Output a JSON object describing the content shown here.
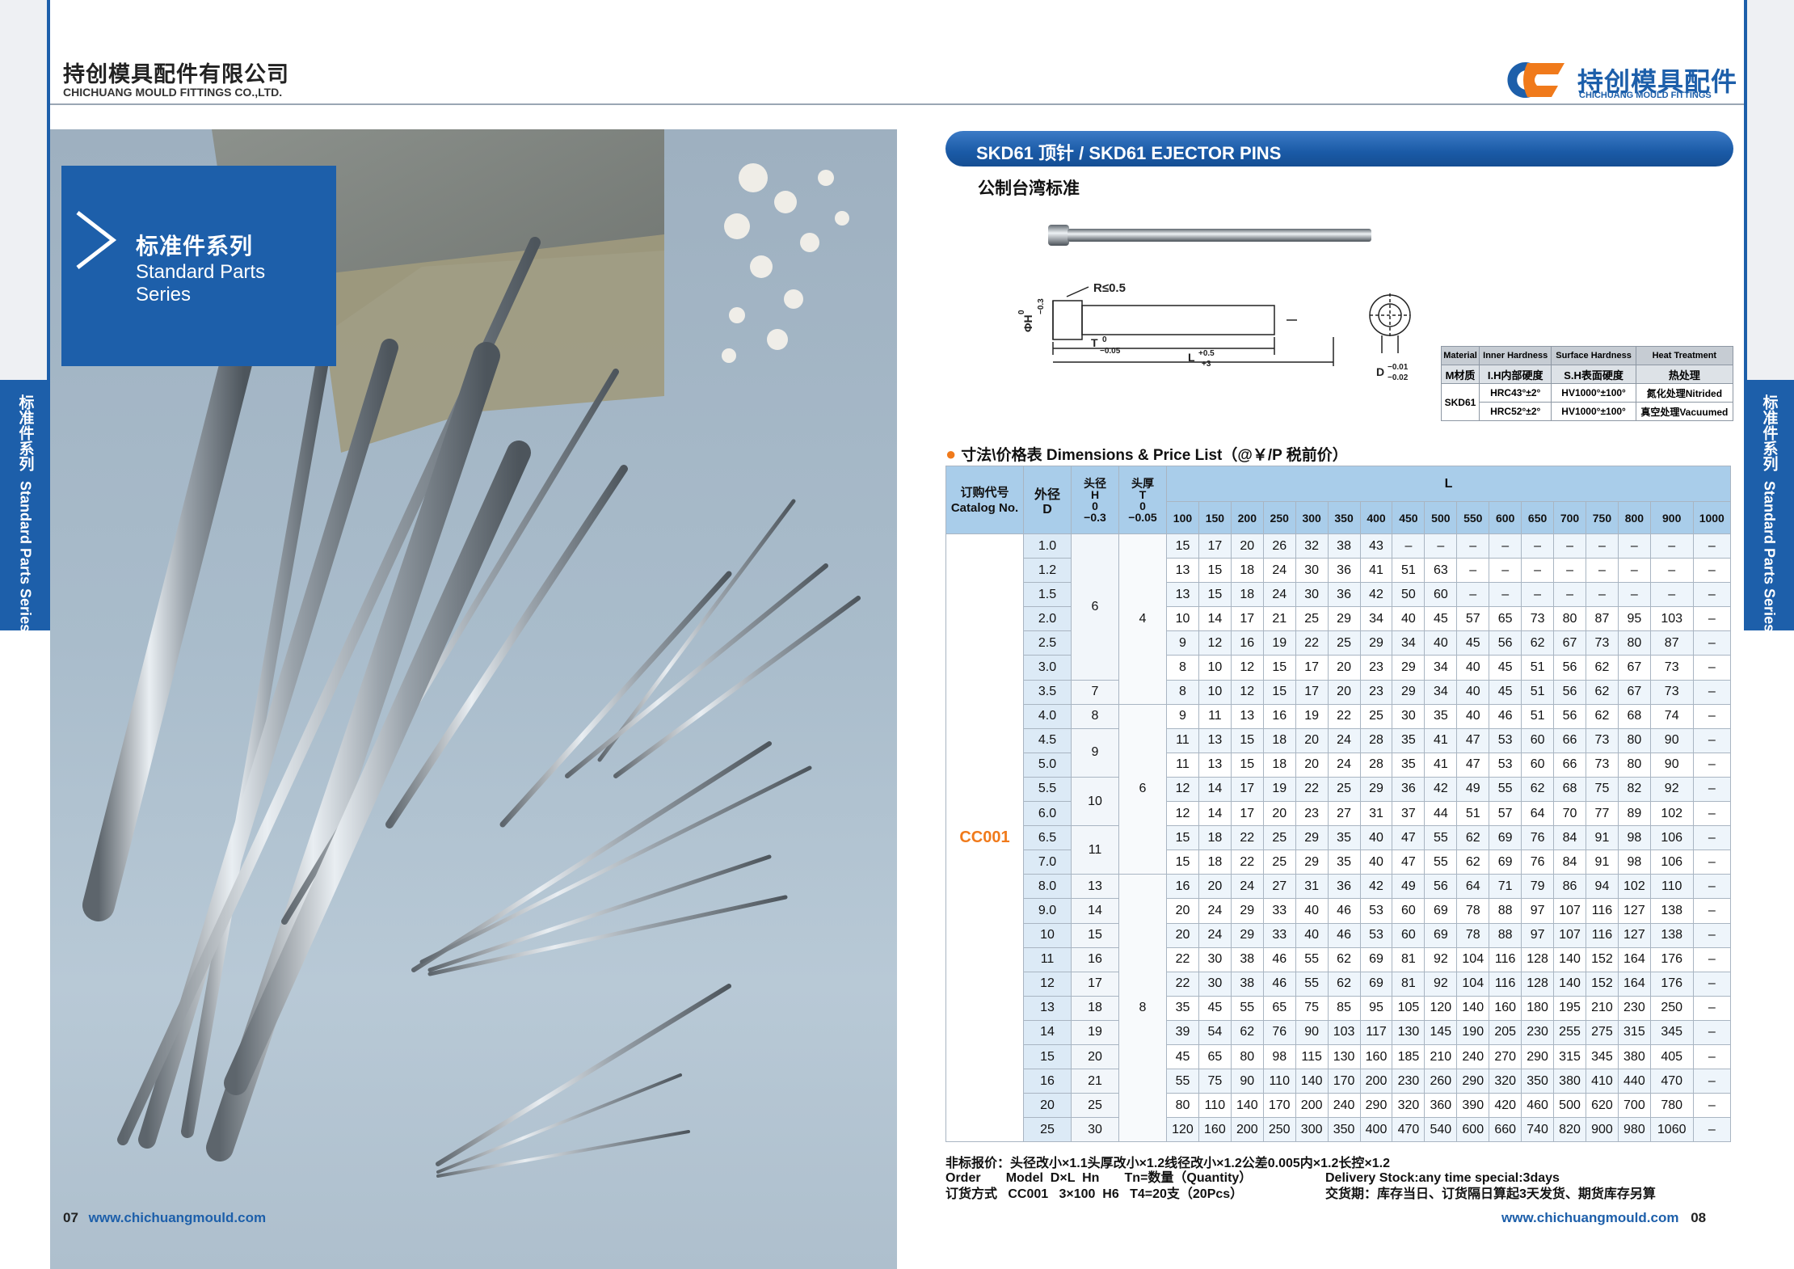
{
  "header": {
    "company_cn": "持创模具配件有限公司",
    "company_en": "CHICHUANG MOULD FITTINGS CO.,LTD.",
    "logo_cn": "持创模具配件",
    "logo_en": "CHICHUANG MOULD FITTINGS"
  },
  "side_tab": {
    "cn": "标准件系列",
    "en": "Standard Parts Series"
  },
  "banner": {
    "cn": "标准件系列",
    "en": "Standard Parts Series"
  },
  "left_footer": {
    "page": "07",
    "url": "www.chichuangmould.com"
  },
  "right_footer": {
    "page": "08",
    "url": "www.chichuangmould.com"
  },
  "title": "SKD61 顶针 / SKD61 EJECTOR PINS",
  "subtitle": "公制台湾标准",
  "drawing": {
    "radius": "R≤0.5",
    "h_label": "ΦH",
    "h_tol_top": "0",
    "h_tol_bot": "−0.3",
    "t_label": "T",
    "t_tol_top": "0",
    "t_tol_bot": "−0.05",
    "l_label": "L",
    "l_tol_top": "+0.5",
    "l_tol_bot": "+3",
    "d_label": "D",
    "d_tol_top": "−0.01",
    "d_tol_bot": "−0.02"
  },
  "material_table": {
    "headers": [
      "Material",
      "Inner Hardness",
      "Surface Hardness",
      "Heat Treatment"
    ],
    "headers_cn": [
      "M材质",
      "I.H内部硬度",
      "S.H表面硬度",
      "热处理"
    ],
    "material": "SKD61",
    "rows": [
      [
        "HRC43°±2°",
        "HV1000°±100°",
        "氮化处理Nitrided"
      ],
      [
        "HRC52°±2°",
        "HV1000°±100°",
        "真空处理Vacuumed"
      ]
    ]
  },
  "price_title": "寸法\\价格表 Dimensions & Price List（@￥/P 税前价）",
  "price_table": {
    "col_catalog": "订购代号 Catalog No.",
    "col_d_cn": "外径",
    "col_d": "D",
    "col_h_cn": "头径",
    "col_h": "H",
    "col_h_tol_top": "0",
    "col_h_tol_bot": "−0.3",
    "col_t_cn": "头厚",
    "col_t": "T",
    "col_t_tol_top": "0",
    "col_t_tol_bot": "−0.05",
    "col_l": "L",
    "catalog": "CC001",
    "lengths": [
      "100",
      "150",
      "200",
      "250",
      "300",
      "350",
      "400",
      "450",
      "500",
      "550",
      "600",
      "650",
      "700",
      "750",
      "800",
      "900",
      "1000"
    ],
    "rows": [
      {
        "d": "1.0",
        "p": [
          "15",
          "17",
          "20",
          "26",
          "32",
          "38",
          "43",
          "–",
          "–",
          "–",
          "–",
          "–",
          "–",
          "–",
          "–",
          "–",
          "–"
        ]
      },
      {
        "d": "1.2",
        "p": [
          "13",
          "15",
          "18",
          "24",
          "30",
          "36",
          "41",
          "51",
          "63",
          "–",
          "–",
          "–",
          "–",
          "–",
          "–",
          "–",
          "–"
        ]
      },
      {
        "d": "1.5",
        "p": [
          "13",
          "15",
          "18",
          "24",
          "30",
          "36",
          "42",
          "50",
          "60",
          "–",
          "–",
          "–",
          "–",
          "–",
          "–",
          "–",
          "–"
        ]
      },
      {
        "d": "2.0",
        "p": [
          "10",
          "14",
          "17",
          "21",
          "25",
          "29",
          "34",
          "40",
          "45",
          "57",
          "65",
          "73",
          "80",
          "87",
          "95",
          "103",
          "–"
        ]
      },
      {
        "d": "2.5",
        "p": [
          "9",
          "12",
          "16",
          "19",
          "22",
          "25",
          "29",
          "34",
          "40",
          "45",
          "56",
          "62",
          "67",
          "73",
          "80",
          "87",
          "–"
        ]
      },
      {
        "d": "3.0",
        "p": [
          "8",
          "10",
          "12",
          "15",
          "17",
          "20",
          "23",
          "29",
          "34",
          "40",
          "45",
          "51",
          "56",
          "62",
          "67",
          "73",
          "–"
        ]
      },
      {
        "d": "3.5",
        "p": [
          "8",
          "10",
          "12",
          "15",
          "17",
          "20",
          "23",
          "29",
          "34",
          "40",
          "45",
          "51",
          "56",
          "62",
          "67",
          "73",
          "–"
        ]
      },
      {
        "d": "4.0",
        "p": [
          "9",
          "11",
          "13",
          "16",
          "19",
          "22",
          "25",
          "30",
          "35",
          "40",
          "46",
          "51",
          "56",
          "62",
          "68",
          "74",
          "–"
        ]
      },
      {
        "d": "4.5",
        "p": [
          "11",
          "13",
          "15",
          "18",
          "20",
          "24",
          "28",
          "35",
          "41",
          "47",
          "53",
          "60",
          "66",
          "73",
          "80",
          "90",
          "–"
        ]
      },
      {
        "d": "5.0",
        "p": [
          "11",
          "13",
          "15",
          "18",
          "20",
          "24",
          "28",
          "35",
          "41",
          "47",
          "53",
          "60",
          "66",
          "73",
          "80",
          "90",
          "–"
        ]
      },
      {
        "d": "5.5",
        "p": [
          "12",
          "14",
          "17",
          "19",
          "22",
          "25",
          "29",
          "36",
          "42",
          "49",
          "55",
          "62",
          "68",
          "75",
          "82",
          "92",
          "–"
        ]
      },
      {
        "d": "6.0",
        "p": [
          "12",
          "14",
          "17",
          "20",
          "23",
          "27",
          "31",
          "37",
          "44",
          "51",
          "57",
          "64",
          "70",
          "77",
          "89",
          "102",
          "–"
        ]
      },
      {
        "d": "6.5",
        "p": [
          "15",
          "18",
          "22",
          "25",
          "29",
          "35",
          "40",
          "47",
          "55",
          "62",
          "69",
          "76",
          "84",
          "91",
          "98",
          "106",
          "–"
        ]
      },
      {
        "d": "7.0",
        "p": [
          "15",
          "18",
          "22",
          "25",
          "29",
          "35",
          "40",
          "47",
          "55",
          "62",
          "69",
          "76",
          "84",
          "91",
          "98",
          "106",
          "–"
        ]
      },
      {
        "d": "8.0",
        "p": [
          "16",
          "20",
          "24",
          "27",
          "31",
          "36",
          "42",
          "49",
          "56",
          "64",
          "71",
          "79",
          "86",
          "94",
          "102",
          "110",
          "–"
        ]
      },
      {
        "d": "9.0",
        "p": [
          "20",
          "24",
          "29",
          "33",
          "40",
          "46",
          "53",
          "60",
          "69",
          "78",
          "88",
          "97",
          "107",
          "116",
          "127",
          "138",
          "–"
        ]
      },
      {
        "d": "10",
        "p": [
          "20",
          "24",
          "29",
          "33",
          "40",
          "46",
          "53",
          "60",
          "69",
          "78",
          "88",
          "97",
          "107",
          "116",
          "127",
          "138",
          "–"
        ]
      },
      {
        "d": "11",
        "p": [
          "22",
          "30",
          "38",
          "46",
          "55",
          "62",
          "69",
          "81",
          "92",
          "104",
          "116",
          "128",
          "140",
          "152",
          "164",
          "176",
          "–"
        ]
      },
      {
        "d": "12",
        "p": [
          "22",
          "30",
          "38",
          "46",
          "55",
          "62",
          "69",
          "81",
          "92",
          "104",
          "116",
          "128",
          "140",
          "152",
          "164",
          "176",
          "–"
        ]
      },
      {
        "d": "13",
        "p": [
          "35",
          "45",
          "55",
          "65",
          "75",
          "85",
          "95",
          "105",
          "120",
          "140",
          "160",
          "180",
          "195",
          "210",
          "230",
          "250",
          "–"
        ]
      },
      {
        "d": "14",
        "p": [
          "39",
          "54",
          "62",
          "76",
          "90",
          "103",
          "117",
          "130",
          "145",
          "190",
          "205",
          "230",
          "255",
          "275",
          "315",
          "345",
          "–"
        ]
      },
      {
        "d": "15",
        "p": [
          "45",
          "65",
          "80",
          "98",
          "115",
          "130",
          "160",
          "185",
          "210",
          "240",
          "270",
          "290",
          "315",
          "345",
          "380",
          "405",
          "–"
        ]
      },
      {
        "d": "16",
        "p": [
          "55",
          "75",
          "90",
          "110",
          "140",
          "170",
          "200",
          "230",
          "260",
          "290",
          "320",
          "350",
          "380",
          "410",
          "440",
          "470",
          "–"
        ]
      },
      {
        "d": "20",
        "p": [
          "80",
          "110",
          "140",
          "170",
          "200",
          "240",
          "290",
          "320",
          "360",
          "390",
          "420",
          "460",
          "500",
          "620",
          "700",
          "780",
          "–"
        ]
      },
      {
        "d": "25",
        "p": [
          "120",
          "160",
          "200",
          "250",
          "300",
          "350",
          "400",
          "470",
          "540",
          "600",
          "660",
          "740",
          "820",
          "900",
          "980",
          "1060",
          "–"
        ]
      }
    ],
    "h_groups": [
      {
        "value": "6",
        "rows": 6
      },
      {
        "value": "7",
        "rows": 1
      },
      {
        "value": "8",
        "rows": 1
      },
      {
        "value": "9",
        "rows": 2
      },
      {
        "value": "10",
        "rows": 2
      },
      {
        "value": "11",
        "rows": 2
      },
      {
        "value": "13",
        "rows": 1
      },
      {
        "value": "14",
        "rows": 1
      },
      {
        "value": "15",
        "rows": 1
      },
      {
        "value": "16",
        "rows": 1
      },
      {
        "value": "17",
        "rows": 1
      },
      {
        "value": "18",
        "rows": 1
      },
      {
        "value": "19",
        "rows": 1
      },
      {
        "value": "20",
        "rows": 1
      },
      {
        "value": "21",
        "rows": 1
      },
      {
        "value": "25",
        "rows": 1
      },
      {
        "value": "30",
        "rows": 1
      }
    ],
    "t_groups": [
      {
        "value": "4",
        "rows": 7
      },
      {
        "value": "6",
        "rows": 7
      },
      {
        "value": "8",
        "rows": 11
      }
    ]
  },
  "notes": {
    "nonstandard": "非标报价：头径改小×1.1头厚改小×1.2线径改小×1.2公差0.005内×1.2长控×1.2",
    "order_left": "Order       Model  D×L  Hn       Tn=数量（Quantity）\n订货方式   CC001   3×100  H6   T4=20支（20Pcs）",
    "order_right": "Delivery Stock:any time special:3days\n交货期：库存当日、订货隔日算起3天发货、期货库存另算"
  },
  "colors": {
    "brand_blue": "#1d5faa",
    "accent_orange": "#f07a1b",
    "table_header": "#a9cdea"
  }
}
